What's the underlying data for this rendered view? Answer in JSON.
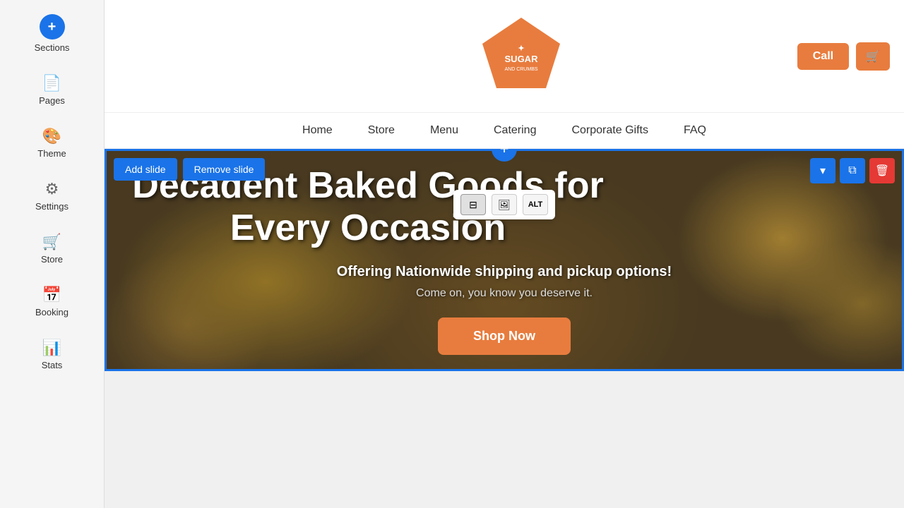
{
  "sidebar": {
    "add_label": "+",
    "items": [
      {
        "id": "sections",
        "label": "Sections",
        "icon": "⊞"
      },
      {
        "id": "pages",
        "label": "Pages",
        "icon": "📄"
      },
      {
        "id": "theme",
        "label": "Theme",
        "icon": "🎨"
      },
      {
        "id": "settings",
        "label": "Settings",
        "icon": "⚙"
      },
      {
        "id": "store",
        "label": "Store",
        "icon": "🛒"
      },
      {
        "id": "booking",
        "label": "Booking",
        "icon": "📅"
      },
      {
        "id": "stats",
        "label": "Stats",
        "icon": "📊"
      }
    ]
  },
  "header": {
    "call_label": "Call",
    "cart_icon": "🛒",
    "logo_text_line1": "SUGAR",
    "logo_text_line2": "AND CRUMBS"
  },
  "nav": {
    "items": [
      {
        "id": "home",
        "label": "Home"
      },
      {
        "id": "store",
        "label": "Store"
      },
      {
        "id": "menu",
        "label": "Menu"
      },
      {
        "id": "catering",
        "label": "Catering"
      },
      {
        "id": "corporate-gifts",
        "label": "Corporate Gifts"
      },
      {
        "id": "faq",
        "label": "FAQ"
      }
    ]
  },
  "hero": {
    "title": "Decadent Baked Goods for Every Occasion",
    "subtitle": "Offering Nationwide shipping and pickup options!",
    "tagline": "Come on, you know you deserve it.",
    "cta_label": "Shop Now",
    "add_slide_label": "Add slide",
    "remove_slide_label": "Remove slide"
  },
  "img_toolbar": {
    "btn1_icon": "⊞",
    "btn2_icon": "🖼",
    "btn3_icon": "ALT"
  },
  "colors": {
    "accent": "#e87c3e",
    "blue": "#1a73e8",
    "delete_red": "#e53935"
  }
}
